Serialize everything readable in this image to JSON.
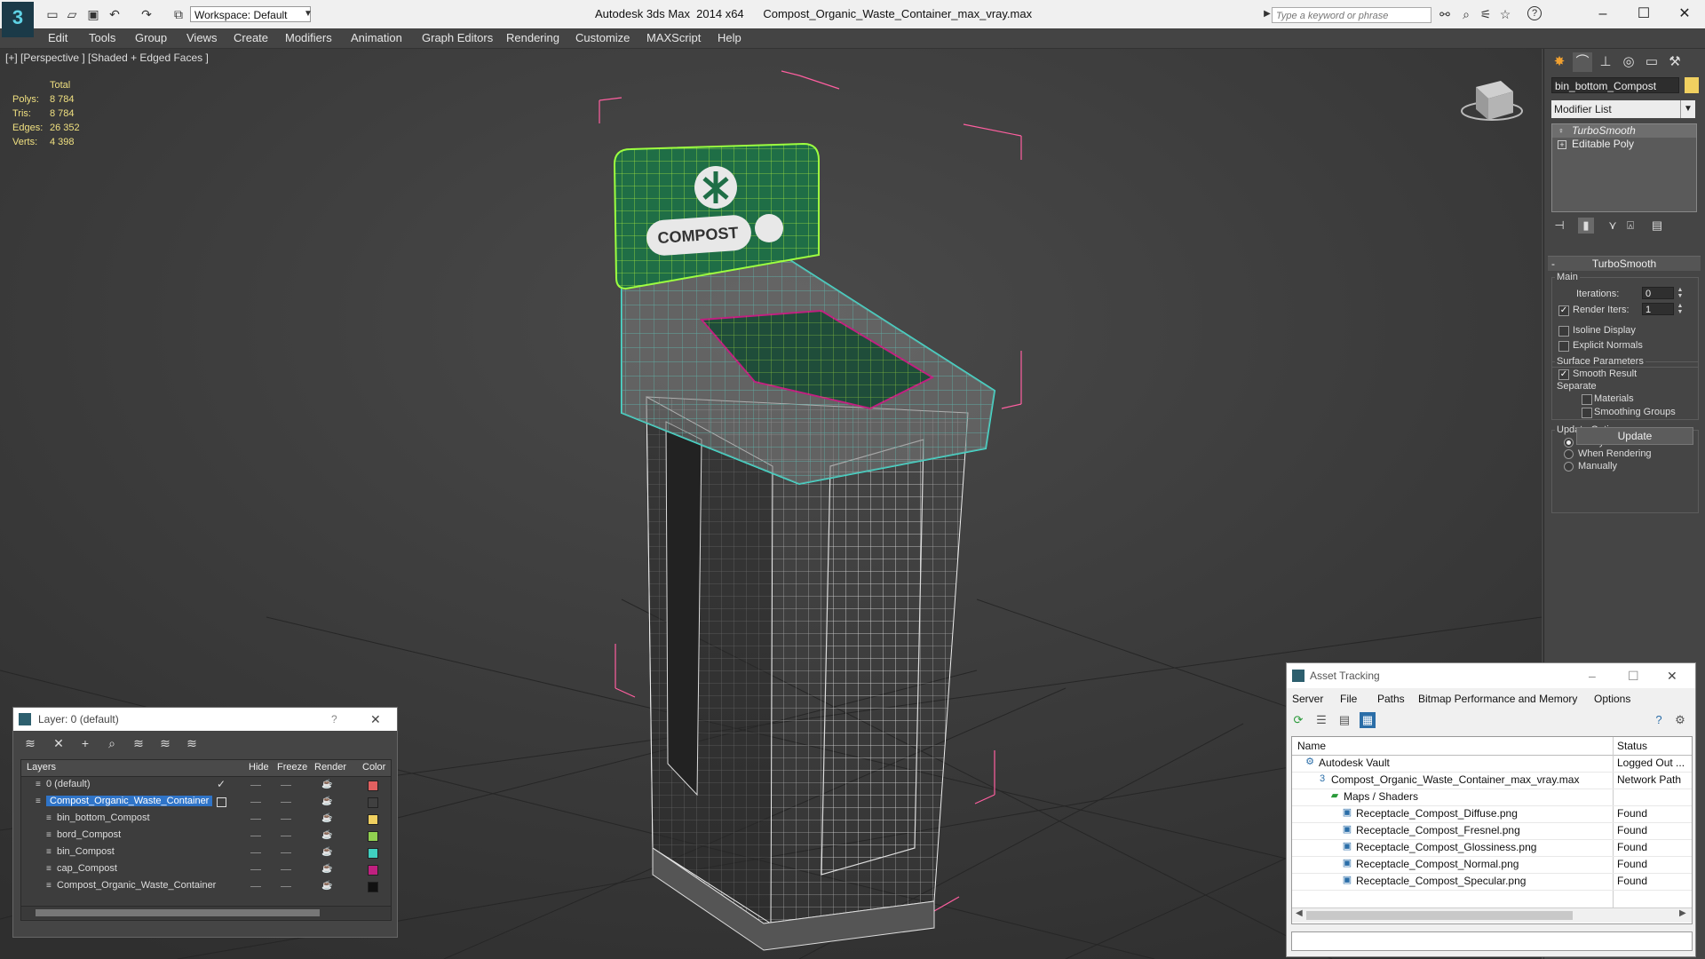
{
  "app": {
    "title": "Autodesk 3ds Max  2014 x64",
    "file": "Compost_Organic_Waste_Container_max_vray.max",
    "workspace": "Workspace: Default",
    "search_placeholder": "Type a keyword or phrase",
    "logo": "3",
    "window_controls": {
      "minimize": "–",
      "maximize": "☐",
      "close": "✕"
    }
  },
  "quick_access": [
    "new-icon",
    "open-icon",
    "save-icon",
    "undo-icon",
    "redo-icon",
    "select-icon"
  ],
  "menu": [
    "Edit",
    "Tools",
    "Group",
    "Views",
    "Create",
    "Modifiers",
    "Animation",
    "Graph Editors",
    "Rendering",
    "Customize",
    "MAXScript",
    "Help"
  ],
  "viewport": {
    "label": "[+] [Perspective ] [Shaded + Edged Faces ]",
    "stats": {
      "header": "Total",
      "rows": [
        {
          "k": "Polys:",
          "v": "8 784"
        },
        {
          "k": "Tris:",
          "v": "8 784"
        },
        {
          "k": "Edges:",
          "v": "26 352"
        },
        {
          "k": "Verts:",
          "v": "4 398"
        }
      ]
    },
    "model_sign_text": "COMPOST"
  },
  "command_panel": {
    "object_name": "bin_bottom_Compost",
    "object_color": "#f0d060",
    "modifier_list": "Modifier List",
    "stack": [
      "TurboSmooth",
      "Editable Poly"
    ],
    "rollout": {
      "title": "TurboSmooth",
      "main_label": "Main",
      "iterations_label": "Iterations:",
      "iterations_value": "0",
      "render_iters_label": "Render Iters:",
      "render_iters_value": "1",
      "isoline": "Isoline Display",
      "explicit_normals": "Explicit Normals",
      "surface_params": "Surface Parameters",
      "smooth_result": "Smooth Result",
      "separate": "Separate",
      "materials": "Materials",
      "smoothing_groups": "Smoothing Groups",
      "update_options": "Update Options",
      "always": "Always",
      "when_rendering": "When Rendering",
      "manually": "Manually",
      "update_btn": "Update"
    }
  },
  "layer_window": {
    "title": "Layer: 0 (default)",
    "help": "?",
    "close": "✕",
    "columns": [
      "Layers",
      "Hide",
      "Freeze",
      "Render",
      "Color"
    ],
    "rows": [
      {
        "name": "0 (default)",
        "color": "#e06060",
        "level": 0,
        "checked": true,
        "selected": false
      },
      {
        "name": "Compost_Organic_Waste_Container",
        "color": "#404040",
        "level": 0,
        "checked": false,
        "selected": true
      },
      {
        "name": "bin_bottom_Compost",
        "color": "#f0d060",
        "level": 1,
        "checked": false,
        "selected": false
      },
      {
        "name": "bord_Compost",
        "color": "#90d050",
        "level": 1,
        "checked": false,
        "selected": false
      },
      {
        "name": "bin_Compost",
        "color": "#40d0c0",
        "level": 1,
        "checked": false,
        "selected": false
      },
      {
        "name": "cap_Compost",
        "color": "#c02080",
        "level": 1,
        "checked": false,
        "selected": false
      },
      {
        "name": "Compost_Organic_Waste_Container",
        "color": "#111111",
        "level": 1,
        "checked": false,
        "selected": false
      }
    ]
  },
  "asset_window": {
    "title": "Asset Tracking",
    "menu": [
      "Server",
      "File",
      "Paths",
      "Bitmap Performance and Memory",
      "Options"
    ],
    "columns": [
      "Name",
      "Status"
    ],
    "rows": [
      {
        "name": "Autodesk Vault",
        "status": "Logged Out ...",
        "indent": 1,
        "icon": "vault-icon"
      },
      {
        "name": "Compost_Organic_Waste_Container_max_vray.max",
        "status": "Network Path",
        "indent": 2,
        "icon": "max-file-icon"
      },
      {
        "name": "Maps / Shaders",
        "status": "",
        "indent": 3,
        "icon": "maps-icon"
      },
      {
        "name": "Receptacle_Compost_Diffuse.png",
        "status": "Found",
        "indent": 4,
        "icon": "image-file-icon"
      },
      {
        "name": "Receptacle_Compost_Fresnel.png",
        "status": "Found",
        "indent": 4,
        "icon": "image-file-icon"
      },
      {
        "name": "Receptacle_Compost_Glossiness.png",
        "status": "Found",
        "indent": 4,
        "icon": "image-file-icon"
      },
      {
        "name": "Receptacle_Compost_Normal.png",
        "status": "Found",
        "indent": 4,
        "icon": "image-file-icon"
      },
      {
        "name": "Receptacle_Compost_Specular.png",
        "status": "Found",
        "indent": 4,
        "icon": "image-file-icon"
      }
    ]
  }
}
